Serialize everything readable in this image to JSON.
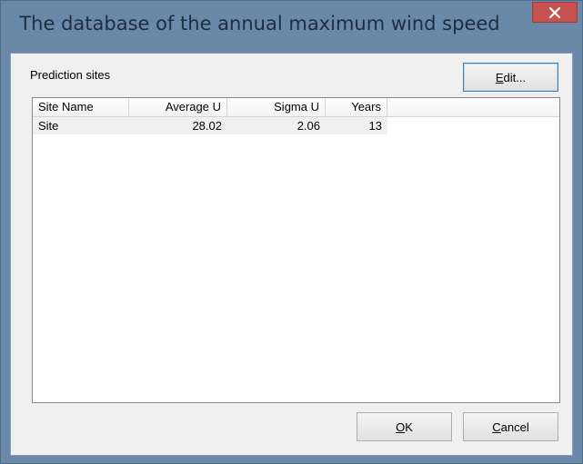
{
  "window": {
    "title": "The database of the annual maximum wind speed",
    "close_glyph": "✕"
  },
  "group": {
    "label": "Prediction sites"
  },
  "buttons": {
    "edit": {
      "accel": "E",
      "rest": "dit..."
    },
    "ok": {
      "accel": "O",
      "rest": "K"
    },
    "cancel": {
      "accel": "C",
      "rest": "ancel"
    }
  },
  "table": {
    "columns": [
      "Site Name",
      "Average U",
      "Sigma U",
      "Years"
    ],
    "rows": [
      [
        "Site",
        "28.02",
        "2.06",
        "13"
      ]
    ]
  },
  "colors": {
    "frame": "#6a89a8",
    "close": "#c75050",
    "client": "#f0f0f0"
  }
}
